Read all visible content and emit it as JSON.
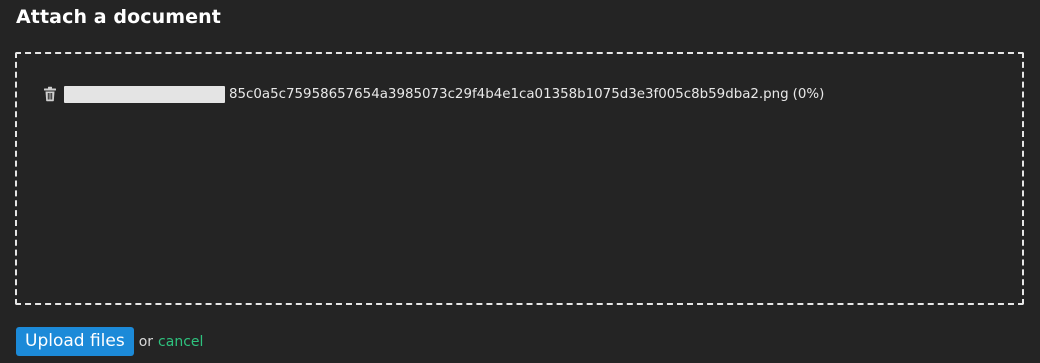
{
  "header": {
    "title": "Attach a document"
  },
  "dropzone": {
    "files": [
      {
        "icon": "trash-icon",
        "name_redacted": true,
        "name": "85c0a5c75958657654a3985073c29f4b4e1ca01358b1075d3e3f005c8b59dba2.png",
        "progress": "(0%)"
      }
    ]
  },
  "footer": {
    "upload_label": "Upload files",
    "or_text": "or",
    "cancel_label": "cancel"
  },
  "colors": {
    "background": "#242424",
    "button": "#1c8ad8",
    "link": "#2ec27e",
    "border": "#e6e6e6"
  }
}
